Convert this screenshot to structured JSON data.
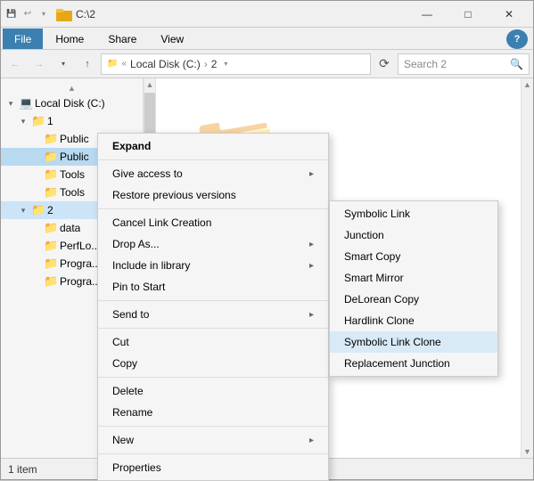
{
  "window": {
    "title": "C:\\2",
    "title_display": "C:\\2"
  },
  "ribbon": {
    "tabs": [
      "File",
      "Home",
      "Share",
      "View"
    ],
    "active_tab": "File"
  },
  "address_bar": {
    "back_label": "←",
    "forward_label": "→",
    "up_label": "↑",
    "path_parts": [
      "Local Disk (C:)",
      "2"
    ],
    "refresh_label": "⟳",
    "search_placeholder": "Search 2",
    "search_text": "Search 2"
  },
  "sidebar": {
    "items": [
      {
        "label": "Local Disk (C:)",
        "level": 0,
        "expanded": true,
        "icon": "💻"
      },
      {
        "label": "1",
        "level": 1,
        "expanded": true,
        "icon": "📁"
      },
      {
        "label": "Public",
        "level": 2,
        "expanded": false,
        "icon": "📁"
      },
      {
        "label": "Public",
        "level": 2,
        "expanded": false,
        "icon": "📁",
        "highlighted": true
      },
      {
        "label": "Tools",
        "level": 2,
        "expanded": false,
        "icon": "📁"
      },
      {
        "label": "Tools",
        "level": 2,
        "expanded": false,
        "icon": "📁"
      },
      {
        "label": "2",
        "level": 1,
        "expanded": true,
        "icon": "📁",
        "selected": true
      },
      {
        "label": "data",
        "level": 2,
        "expanded": false,
        "icon": "📁"
      },
      {
        "label": "PerfLo...",
        "level": 2,
        "expanded": false,
        "icon": "📁"
      },
      {
        "label": "Progra...",
        "level": 2,
        "expanded": false,
        "icon": "📁"
      },
      {
        "label": "Progra...",
        "level": 2,
        "expanded": false,
        "icon": "📁"
      }
    ]
  },
  "status_bar": {
    "text": "1 item"
  },
  "context_menu": {
    "items": [
      {
        "label": "Expand",
        "type": "item",
        "bold": true
      },
      {
        "label": "Give access to",
        "type": "item",
        "arrow": true,
        "separator_above": false
      },
      {
        "label": "Restore previous versions",
        "type": "item"
      },
      {
        "label": "Cancel Link Creation",
        "type": "item",
        "separator_above": true
      },
      {
        "label": "Drop As...",
        "type": "item",
        "arrow": true
      },
      {
        "label": "Include in library",
        "type": "item",
        "arrow": true
      },
      {
        "label": "Pin to Start",
        "type": "item"
      },
      {
        "label": "Send to",
        "type": "item",
        "arrow": true,
        "separator_above": true
      },
      {
        "label": "Cut",
        "type": "item",
        "separator_above": true
      },
      {
        "label": "Copy",
        "type": "item"
      },
      {
        "label": "Delete",
        "type": "item",
        "separator_above": true
      },
      {
        "label": "Rename",
        "type": "item"
      },
      {
        "label": "New",
        "type": "item",
        "arrow": true,
        "separator_above": true
      },
      {
        "label": "Properties",
        "type": "item",
        "separator_above": true
      }
    ]
  },
  "submenu": {
    "items": [
      {
        "label": "Symbolic Link"
      },
      {
        "label": "Junction"
      },
      {
        "label": "Smart Copy"
      },
      {
        "label": "Smart Mirror"
      },
      {
        "label": "DeLorean Copy"
      },
      {
        "label": "Hardlink Clone"
      },
      {
        "label": "Symbolic Link Clone",
        "highlighted": true
      },
      {
        "label": "Replacement Junction"
      }
    ]
  },
  "icons": {
    "folder": "📁",
    "computer": "💻",
    "arrow_right": "▸",
    "arrow_down": "▾",
    "chevron_right": "❯",
    "search": "🔍",
    "minimize": "—",
    "maximize": "□",
    "close": "✕"
  }
}
